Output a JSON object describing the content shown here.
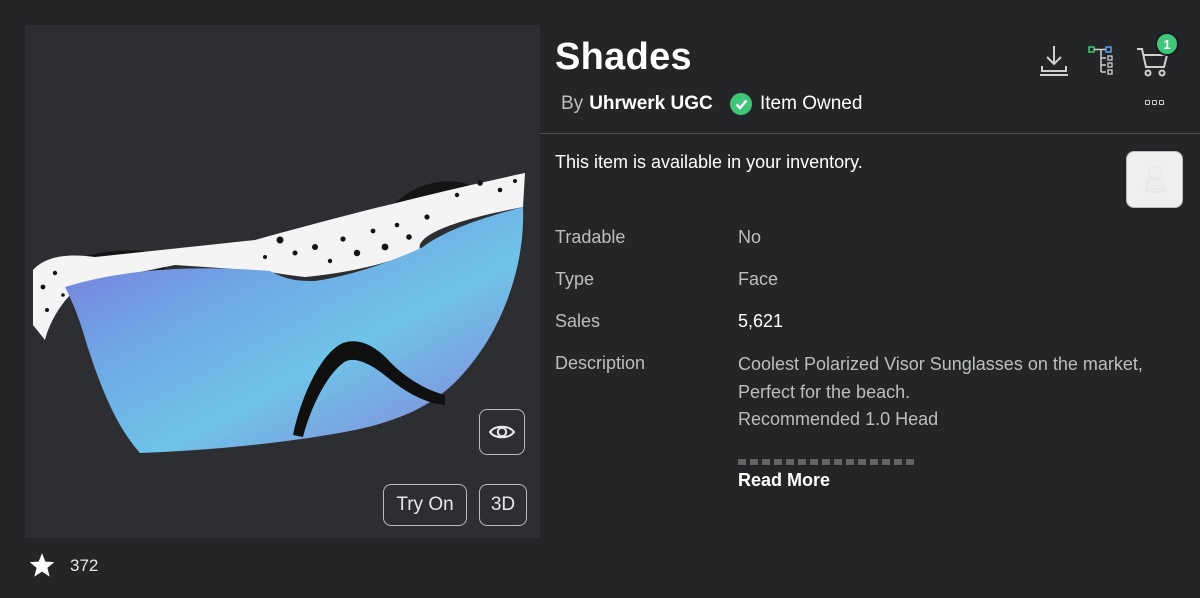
{
  "item": {
    "title": "Shades",
    "by_prefix": "By",
    "creator": "Uhrwerk UGC",
    "owned_label": "Item Owned",
    "favorites": "372"
  },
  "thumbnail": {
    "try_on_label": "Try On",
    "view_3d_label": "3D"
  },
  "header_icons": {
    "cart_count": "1",
    "icons": [
      "download-icon",
      "hierarchy-icon",
      "cart-icon",
      "more-options-icon"
    ]
  },
  "availability_text": "This item is available in your inventory.",
  "details": {
    "tradable_label": "Tradable",
    "tradable_value": "No",
    "type_label": "Type",
    "type_value": "Face",
    "sales_label": "Sales",
    "sales_value": "5,621",
    "description_label": "Description",
    "description_lines": [
      "Coolest Polarized Visor Sunglasses on the market,",
      "Perfect for the beach.",
      "Recommended 1.0 Head"
    ],
    "read_more_label": "Read More"
  },
  "colors": {
    "background": "#232527",
    "panel": "#2c2e31",
    "owned_green": "#3fc679",
    "lens_blue": "#6fbfe6",
    "lens_purple": "#8b79d6"
  }
}
